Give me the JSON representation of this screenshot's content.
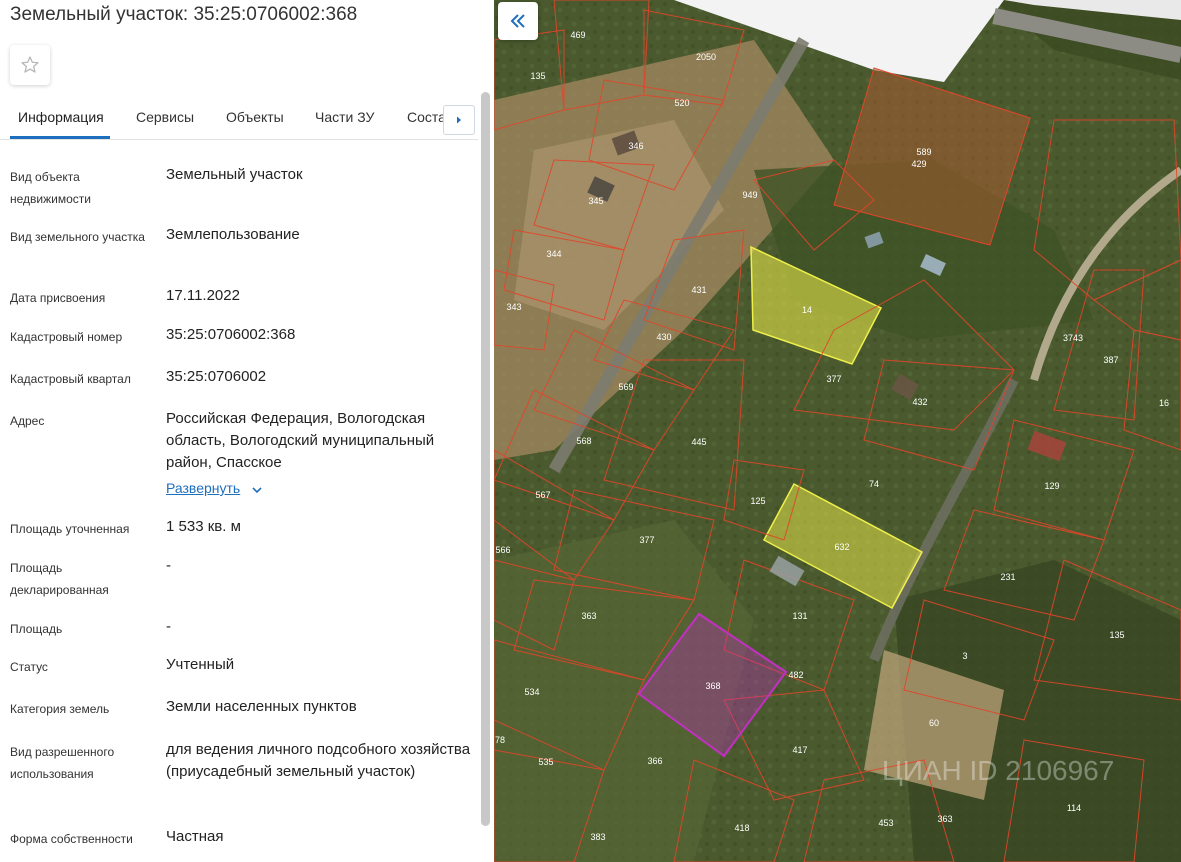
{
  "panel": {
    "title": "Земельный участок: 35:25:0706002:368",
    "tabs": [
      "Информация",
      "Сервисы",
      "Объекты",
      "Части ЗУ",
      "Состав"
    ],
    "fields": [
      {
        "label": "Вид объекта недвижимости",
        "value": "Земельный участок"
      },
      {
        "label": "Вид земельного участка",
        "value": "Землепользование"
      },
      {
        "label": "Дата присвоения",
        "value": "17.11.2022"
      },
      {
        "label": "Кадастровый номер",
        "value": "35:25:0706002:368"
      },
      {
        "label": "Кадастровый квартал",
        "value": "35:25:0706002"
      },
      {
        "label": "Адрес",
        "value": "Российская Федерация, Вологодская область, Вологодский муниципальный район, Спасское"
      },
      {
        "label": "Площадь уточненная",
        "value": "1 533 кв. м"
      },
      {
        "label": "Площадь декларированная",
        "value": "-"
      },
      {
        "label": "Площадь",
        "value": "-"
      },
      {
        "label": "Статус",
        "value": "Учтенный"
      },
      {
        "label": "Категория земель",
        "value": "Земли населенных пунктов"
      },
      {
        "label": "Вид разрешенного использования",
        "value": "для ведения личного подсобного хозяйства (приусадебный земельный участок)"
      },
      {
        "label": "Форма собственности",
        "value": "Частная"
      }
    ],
    "expand_label": "Развернуть"
  },
  "map": {
    "plot_labels": [
      "469",
      "2050",
      "135",
      "520",
      "346",
      "345",
      "344",
      "343",
      "949",
      "589",
      "429",
      "14",
      "431",
      "430",
      "569",
      "568",
      "567",
      "566",
      "445",
      "377",
      "363",
      "131",
      "125",
      "632",
      "368",
      "482",
      "534",
      "535",
      "366",
      "417",
      "418",
      "383",
      "453",
      "363",
      "60",
      "3",
      "231",
      "135",
      "129",
      "74",
      "432",
      "377",
      "3743",
      "387",
      "16",
      "114",
      "78"
    ],
    "watermark": "ЦИАН ID 2106967",
    "selected_color": "#c32fc3",
    "highlight_color": "#f0f04a",
    "boundary_color": "#e2452a"
  },
  "icons": {
    "favorite": "star-icon",
    "tabs_next": "chevron-right-icon",
    "expand": "chevron-down-icon",
    "collapse": "double-chevron-left-icon"
  }
}
